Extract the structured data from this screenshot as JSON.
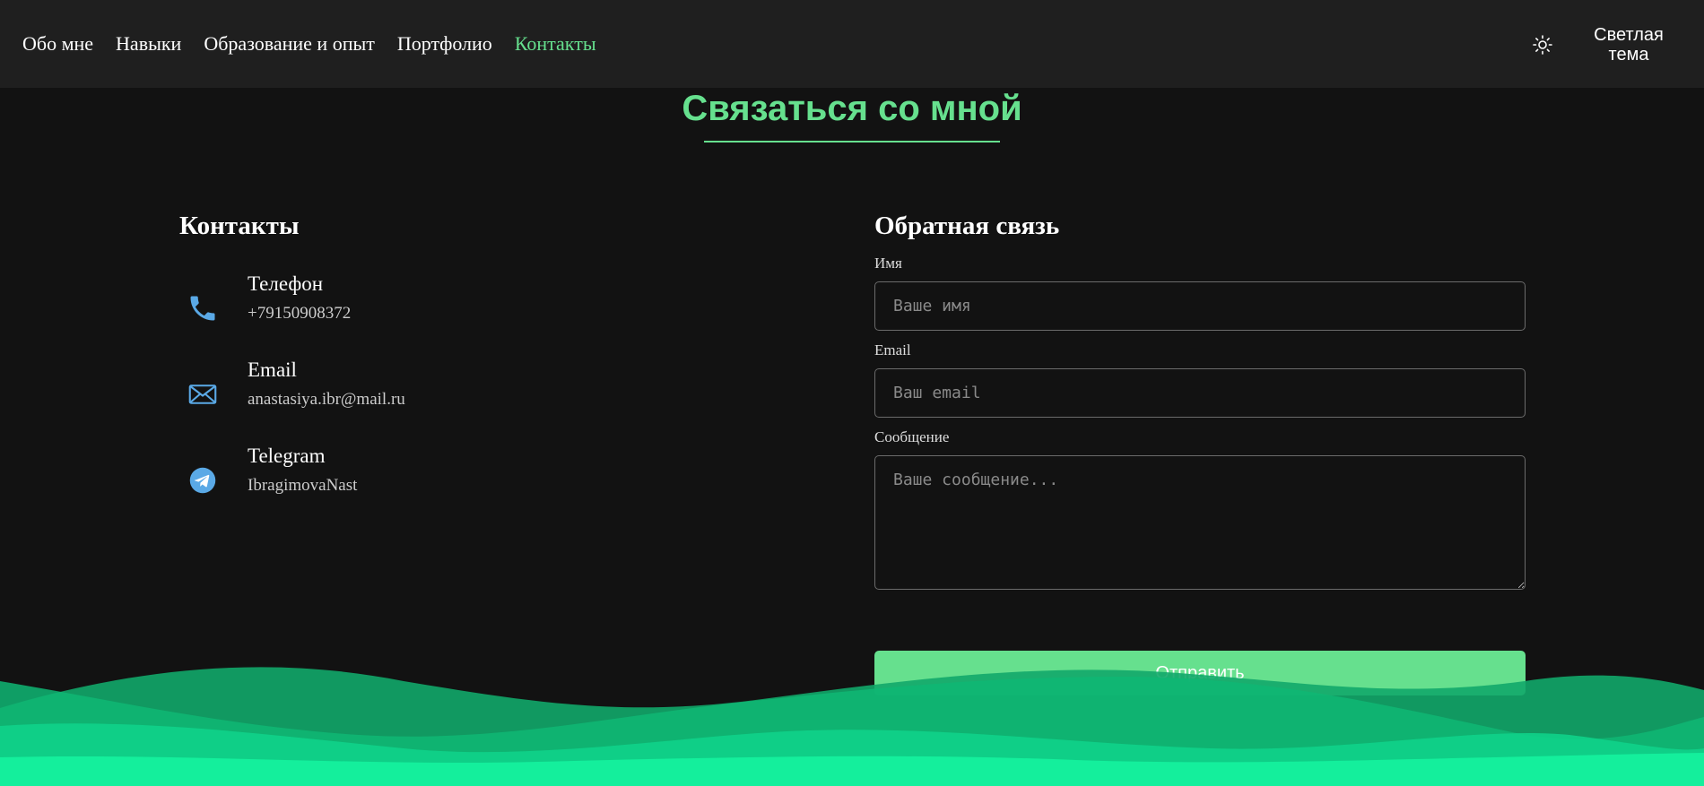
{
  "nav": {
    "items": [
      {
        "label": "Обо мне"
      },
      {
        "label": "Навыки"
      },
      {
        "label": "Образование и опыт"
      },
      {
        "label": "Портфолио"
      },
      {
        "label": "Контакты",
        "active": true
      }
    ]
  },
  "theme_toggle": {
    "icon": "sun-icon",
    "label": "Светлая тема"
  },
  "section": {
    "title": "Связаться со мной"
  },
  "contacts": {
    "title": "Контакты",
    "items": [
      {
        "icon": "phone-icon",
        "title": "Телефон",
        "value": "+79150908372"
      },
      {
        "icon": "mail-icon",
        "title": "Email",
        "value": "anastasiya.ibr@mail.ru"
      },
      {
        "icon": "telegram-icon",
        "title": "Telegram",
        "value": "IbragimovaNast"
      }
    ]
  },
  "feedback": {
    "title": "Обратная связь",
    "name_label": "Имя",
    "name_placeholder": "Ваше имя",
    "email_label": "Email",
    "email_placeholder": "Ваш email",
    "message_label": "Сообщение",
    "message_placeholder": "Ваше сообщение...",
    "submit_label": "Отправить"
  },
  "colors": {
    "accent": "#66e08e",
    "background": "#121212",
    "header": "#1f1f1f",
    "icon_blue": "#5aa9e6"
  }
}
